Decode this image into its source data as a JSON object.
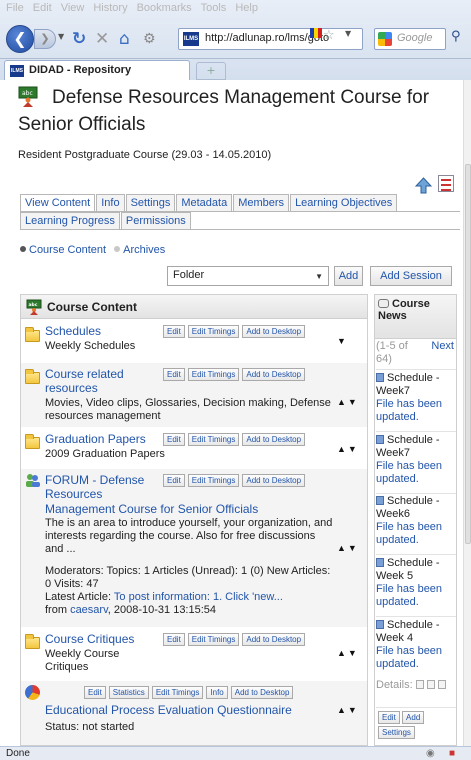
{
  "browser": {
    "menu": [
      "File",
      "Edit",
      "View",
      "History",
      "Bookmarks",
      "Tools",
      "Help"
    ],
    "url": "http://adlunap.ro/lms/goto",
    "search_placeholder": "Google",
    "tab_title": "DIDAD - Repository",
    "new_tab": "+",
    "status": "Done"
  },
  "course": {
    "title": "Defense Resources Management Course for Senior Officials",
    "subtitle": "Resident Postgraduate Course (29.03 - 14.05.2010)"
  },
  "tabs_row1": [
    "View Content",
    "Info",
    "Settings",
    "Metadata",
    "Members",
    "Learning Objectives"
  ],
  "tabs_row2": [
    "Learning Progress",
    "Permissions"
  ],
  "subnav": {
    "current": "Course Content",
    "other": "Archives"
  },
  "toolbar": {
    "select_value": "Folder",
    "add_label": "Add",
    "add_session_label": "Add Session"
  },
  "content": {
    "header": "Course Content",
    "actions": [
      "Edit",
      "Edit Timings",
      "Add to Desktop"
    ],
    "items": [
      {
        "title": "Schedules",
        "description": "Weekly Schedules"
      },
      {
        "title": "Course related resources",
        "description": "Movies, Video clips, Glossaries, Decision making, Defense resources management"
      },
      {
        "title": "Graduation Papers",
        "description": "2009 Graduation Papers"
      },
      {
        "title": "FORUM - Defense Resources",
        "subtitle": "Management Course for Senior Officials",
        "description": "The is an area to introduce yourself, your organization, and interests regarding the course. Also for free discussions and ...",
        "stats": "Moderators: Topics: 1 Articles (Unread): 1 (0) New Articles: 0 Visits: 47",
        "latest_label": "Latest Article:",
        "latest_link": "To post information: 1. Click 'new...",
        "from_label": "from",
        "from_user": "caesarv",
        "from_date": ", 2008-10-31 13:15:54"
      },
      {
        "title": "Course Critiques",
        "description": "Weekly Course Critiques"
      },
      {
        "actions": [
          "Edit",
          "Statistics",
          "Edit Timings",
          "Info",
          "Add to Desktop"
        ],
        "title": "Educational Process Evaluation Questionnaire",
        "description": "Status: not started"
      }
    ]
  },
  "news": {
    "header": "Course News",
    "paging": "(1-5 of 64)",
    "next": "Next",
    "items": [
      {
        "title": "Schedule - Week7",
        "text": "File has been updated."
      },
      {
        "title": "Schedule - Week7",
        "text": "File has been updated."
      },
      {
        "title": "Schedule - Week6",
        "text": "File has been updated."
      },
      {
        "title": "Schedule - Week 5",
        "text": "File has been updated."
      },
      {
        "title": "Schedule - Week 4",
        "text": "File has been updated."
      }
    ],
    "details_label": "Details:",
    "buttons": [
      "Edit",
      "Add",
      "Settings"
    ]
  }
}
